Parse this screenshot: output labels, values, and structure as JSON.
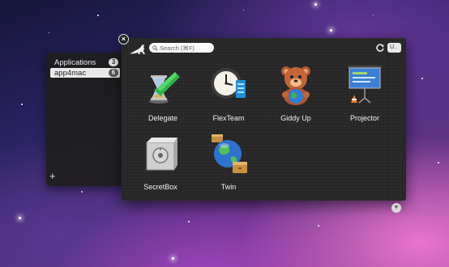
{
  "sidebar": {
    "items": [
      {
        "label": "Applications",
        "count": "3"
      },
      {
        "label": "app4mac",
        "count": "6"
      }
    ],
    "add_label": "+"
  },
  "toolbar": {
    "search_placeholder": "Search (⌘F)",
    "sort_label": "U..",
    "close_icon": "close-icon",
    "refresh_icon": "refresh-icon"
  },
  "apps": [
    {
      "label": "Delegate",
      "icon": "delegate-icon"
    },
    {
      "label": "FlexTeam",
      "icon": "flexteam-icon"
    },
    {
      "label": "Giddy Up",
      "icon": "giddy-up-icon"
    },
    {
      "label": "Projector",
      "icon": "projector-icon"
    },
    {
      "label": "SecretBox",
      "icon": "secretbox-icon"
    },
    {
      "label": "Twin",
      "icon": "twin-icon"
    }
  ],
  "colors": {
    "panel": "#262626",
    "selected": "#e9e9e9",
    "accent_green": "#2fb24a"
  }
}
